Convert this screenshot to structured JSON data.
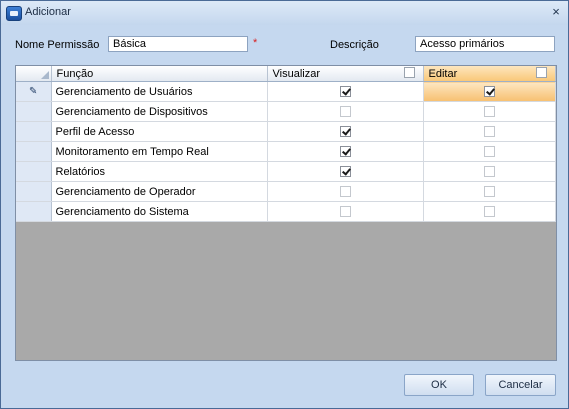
{
  "window": {
    "title": "Adicionar",
    "close_glyph": "×"
  },
  "form": {
    "permission_label": "Nome Permissão",
    "permission_value": "Básica",
    "required_marker": "*",
    "description_label": "Descrição",
    "description_value": "Acesso primários"
  },
  "grid": {
    "columns": {
      "function": "Função",
      "view": "Visualizar",
      "edit": "Editar"
    },
    "header_checks": {
      "view": false,
      "edit": false
    },
    "current_row_glyph": "✎",
    "rows": [
      {
        "name": "Gerenciamento de Usuários",
        "view": true,
        "edit": true
      },
      {
        "name": "Gerenciamento de Dispositivos",
        "view": false,
        "edit": false
      },
      {
        "name": "Perfil de Acesso",
        "view": true,
        "edit": false
      },
      {
        "name": "Monitoramento em Tempo Real",
        "view": true,
        "edit": false
      },
      {
        "name": "Relatórios",
        "view": true,
        "edit": false
      },
      {
        "name": "Gerenciamento de Operador",
        "view": false,
        "edit": false
      },
      {
        "name": "Gerenciamento do Sistema",
        "view": false,
        "edit": false
      }
    ]
  },
  "buttons": {
    "ok": "OK",
    "cancel": "Cancelar"
  },
  "colors": {
    "dialog_bg": "#c5d8ef",
    "grid_empty": "#a9a9a9",
    "active_cell": "#f9c879"
  }
}
